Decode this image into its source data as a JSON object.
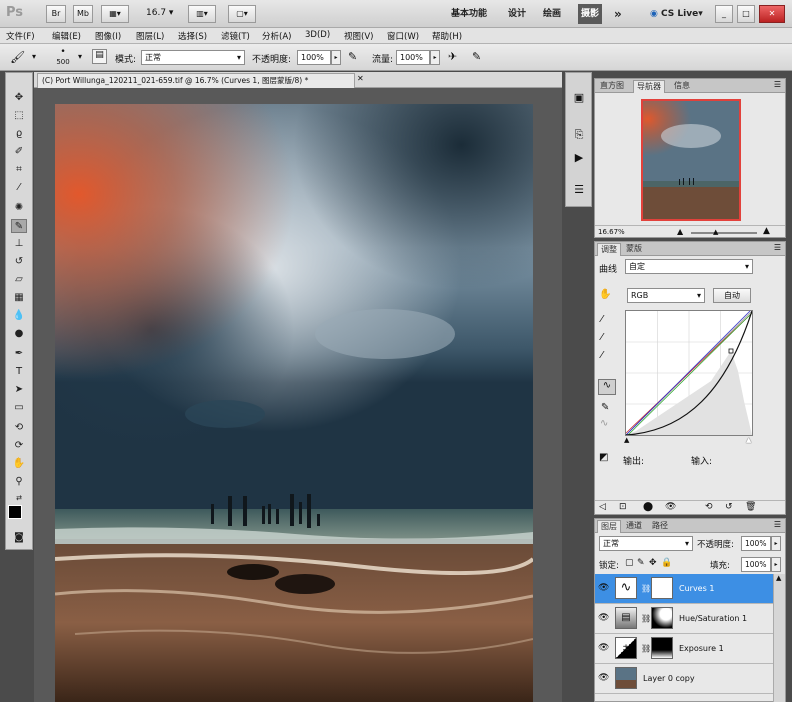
{
  "titlebar": {
    "app_logo": "Ps",
    "bridge": "Br",
    "minibridge": "Mb",
    "zoom": "16.7",
    "workspaces": [
      "基本功能",
      "设计",
      "绘画",
      "摄影"
    ],
    "more": "»",
    "cslive": "CS Live"
  },
  "menu": [
    "文件(F)",
    "编辑(E)",
    "图像(I)",
    "图层(L)",
    "选择(S)",
    "滤镜(T)",
    "分析(A)",
    "3D(D)",
    "视图(V)",
    "窗口(W)",
    "帮助(H)"
  ],
  "options": {
    "brush_size": "500",
    "mode_label": "模式:",
    "mode_value": "正常",
    "opacity_label": "不透明度:",
    "opacity_value": "100%",
    "flow_label": "流量:",
    "flow_value": "100%"
  },
  "document": {
    "tab_title": "(C) Port Willunga_120211_021-659.tif @ 16.7% (Curves 1, 图层蒙版/8) *"
  },
  "navigator": {
    "tabs": [
      "直方图",
      "导航器",
      "信息"
    ],
    "zoom": "16.67%"
  },
  "adjustments": {
    "tabs": [
      "调整",
      "蒙版"
    ],
    "curves_label": "曲线",
    "preset": "自定",
    "channel": "RGB",
    "auto": "自动",
    "output_label": "输出:",
    "input_label": "输入:"
  },
  "layers": {
    "tabs": [
      "图层",
      "通道",
      "路径"
    ],
    "blend": "正常",
    "opacity_label": "不透明度:",
    "opacity": "100%",
    "lock_label": "锁定:",
    "fill_label": "填充:",
    "fill": "100%",
    "items": [
      {
        "name": "Curves 1",
        "selected": true
      },
      {
        "name": "Hue/Saturation 1",
        "selected": false
      },
      {
        "name": "Exposure 1",
        "selected": false
      },
      {
        "name": "Layer 0 copy",
        "selected": false
      }
    ]
  },
  "colors": {
    "selection": "#3d8fe4",
    "panel_bg": "#e8e8e8"
  }
}
